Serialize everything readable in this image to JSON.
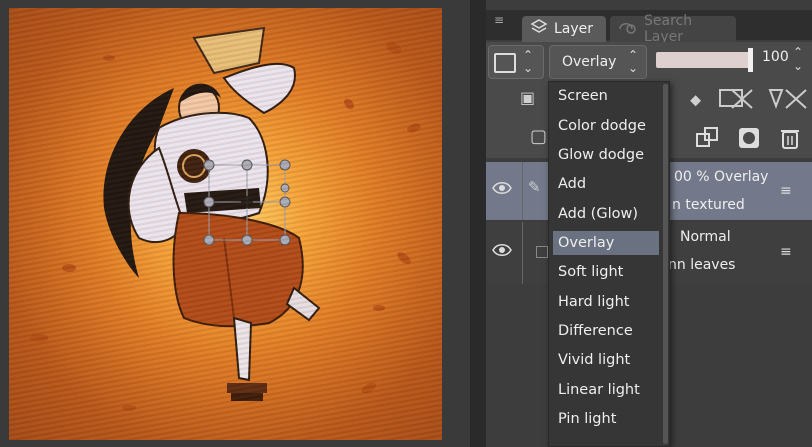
{
  "tabs": [
    {
      "label": "Layer",
      "icon": "layers-icon"
    },
    {
      "label": "Search Layer",
      "icon": "search-layer-icon"
    }
  ],
  "layer_properties": {
    "blend_mode": "Overlay",
    "opacity": "100"
  },
  "layers": [
    {
      "opacity_mode": "00 %  Overlay",
      "name": "n textured",
      "selected": true
    },
    {
      "opacity_mode": "Normal",
      "name": "nn leaves",
      "selected": false
    }
  ],
  "blend_menu": {
    "items": [
      "Screen",
      "Color dodge",
      "Glow dodge",
      "Add",
      "Add (Glow)",
      "Overlay",
      "Soft light",
      "Hard light",
      "Difference",
      "Vivid light",
      "Linear light",
      "Pin light"
    ],
    "selected": "Overlay"
  },
  "colors": {
    "selected_layer": "#73798a",
    "selected_menu_item": "#6a7180",
    "canvas_orange": "#e07c26"
  }
}
